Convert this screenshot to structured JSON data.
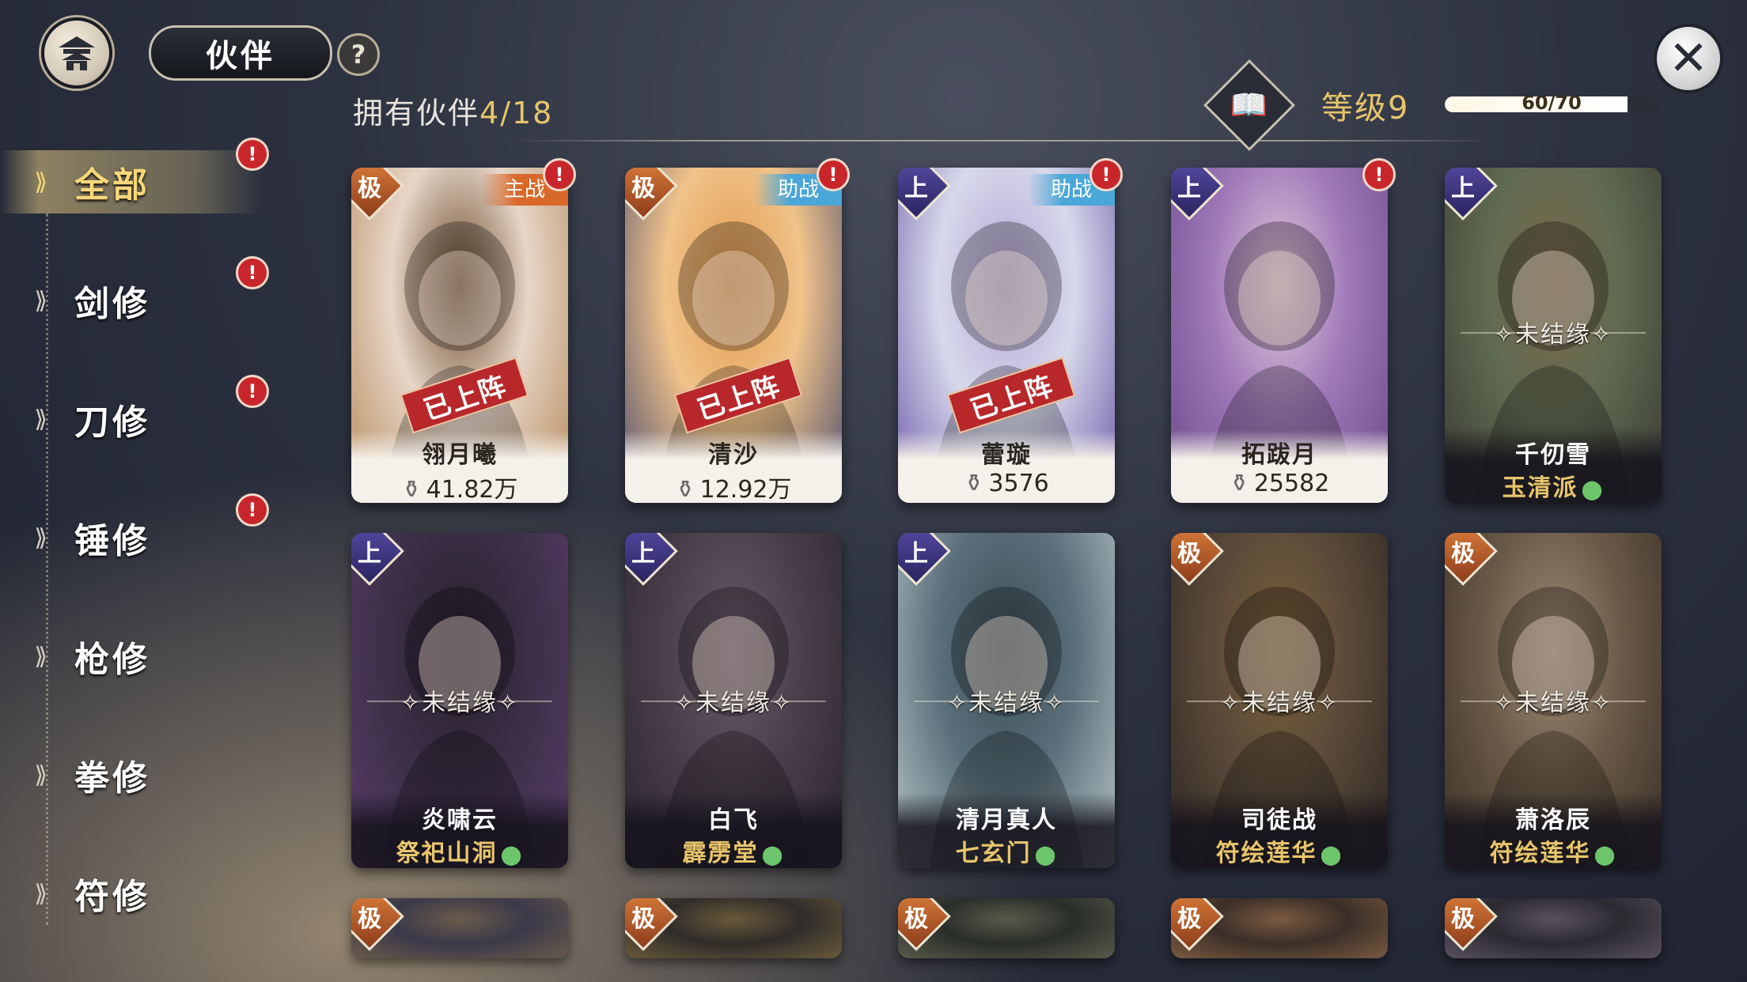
{
  "header": {
    "title": "伙伴",
    "help": "?",
    "close": "✕",
    "owned_label": "拥有伙伴",
    "owned_count": "4/18",
    "book_icon": "📖",
    "level": "等级9",
    "xp_text": "60/70",
    "xp_fraction": 0.857
  },
  "sidebar": {
    "items": [
      {
        "label": "全部",
        "active": true,
        "alert": "!"
      },
      {
        "label": "剑修",
        "alert": "!"
      },
      {
        "label": "刀修",
        "alert": "!"
      },
      {
        "label": "锤修",
        "alert": "!"
      },
      {
        "label": "枪修"
      },
      {
        "label": "拳修"
      },
      {
        "label": "符修"
      }
    ],
    "arrow": "⟫"
  },
  "deployed_text": "已上阵",
  "unbound_text": "✧未结缘✧",
  "power_icon": "⚱",
  "pin_icon": "⬤",
  "cards": [
    {
      "rank": "极",
      "role": "主战",
      "deployed": true,
      "alert": "!",
      "name": "翎月曦",
      "power": "41.82万",
      "colors": [
        "#e7d6c8",
        "#b58a5a",
        "#6b4a2c"
      ]
    },
    {
      "rank": "极",
      "role": "助战",
      "deployed": true,
      "alert": "!",
      "name": "清沙",
      "power": "12.92万",
      "colors": [
        "#f0c38a",
        "#4b4c6c",
        "#e39a4e"
      ]
    },
    {
      "rank": "上",
      "role": "助战",
      "deployed": true,
      "alert": "!",
      "name": "蕾璇",
      "power": "3576",
      "colors": [
        "#d7d9ea",
        "#6c5aa8",
        "#b8a7d8"
      ]
    },
    {
      "rank": "上",
      "alert": "!",
      "name": "拓跋月",
      "power": "25582",
      "colors": [
        "#9f79b8",
        "#6a4a8a",
        "#e2c8d9"
      ]
    },
    {
      "rank": "上",
      "name": "千仞雪",
      "location": "玉清派",
      "colors": [
        "#5f6a52",
        "#3b3b33",
        "#7a6a4a"
      ]
    },
    {
      "rank": "上",
      "name": "炎啸云",
      "location": "祭祀山洞",
      "colors": [
        "#3a2f45",
        "#5a3b6a",
        "#2a2230"
      ]
    },
    {
      "rank": "上",
      "name": "白飞",
      "location": "霹雳堂",
      "colors": [
        "#4a3f4a",
        "#2a2530",
        "#6a5a6a"
      ]
    },
    {
      "rank": "上",
      "name": "清月真人",
      "location": "七玄门",
      "colors": [
        "#5a6f7a",
        "#b8c6c9",
        "#3d5058"
      ]
    },
    {
      "rank": "极",
      "name": "司徒战",
      "location": "符绘莲华",
      "colors": [
        "#5a4a3a",
        "#2e2722",
        "#7a5f3a"
      ]
    },
    {
      "rank": "极",
      "name": "萧洛辰",
      "location": "符绘莲华",
      "colors": [
        "#6a5a48",
        "#3a3026",
        "#9c8a74"
      ]
    },
    {
      "rank": "极",
      "colors": [
        "#3b3a4a",
        "#6a5a4a"
      ]
    },
    {
      "rank": "极",
      "colors": [
        "#2f2c2a",
        "#6a5a3a"
      ]
    },
    {
      "rank": "极",
      "colors": [
        "#2a2e2a",
        "#5a5a4a"
      ]
    },
    {
      "rank": "极",
      "colors": [
        "#3a2f28",
        "#7a5a40"
      ]
    },
    {
      "rank": "极",
      "colors": [
        "#2a2a30",
        "#5a5060"
      ]
    }
  ]
}
